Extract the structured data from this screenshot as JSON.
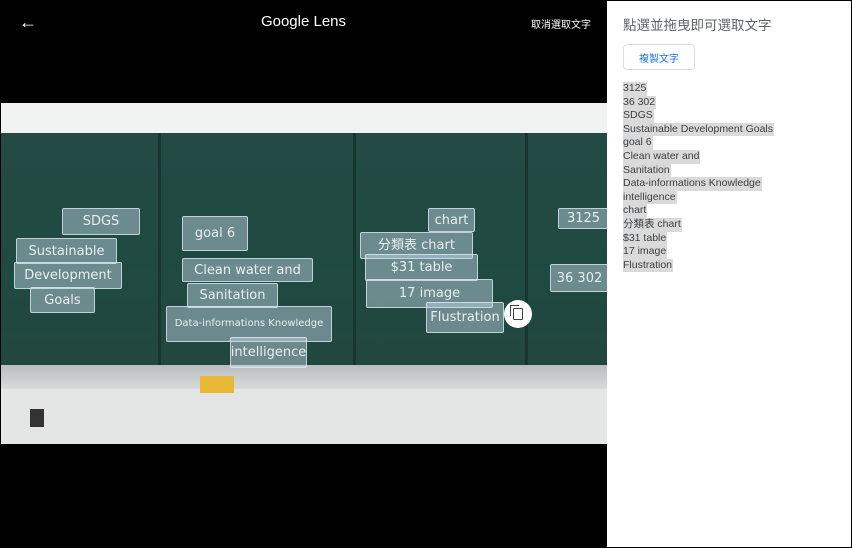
{
  "header": {
    "title": "Google Lens",
    "cancel_label": "取消選取文字",
    "back_icon": "arrow-left-icon"
  },
  "photo": {
    "text_boxes": [
      {
        "text": "SDGS"
      },
      {
        "text": "Sustainable"
      },
      {
        "text": "Development"
      },
      {
        "text": "Goals"
      },
      {
        "text": "goal 6"
      },
      {
        "text": "Clean water and"
      },
      {
        "text": "Sanitation"
      },
      {
        "text": "Data-informations Knowledge"
      },
      {
        "text": "intelligence"
      },
      {
        "text": "chart"
      },
      {
        "text": "分類表 chart"
      },
      {
        "text": "$31 table"
      },
      {
        "text": "17 image"
      },
      {
        "text": "Flustration"
      },
      {
        "text": "3125"
      },
      {
        "text": "36 302"
      }
    ],
    "copy_icon": "copy-icon"
  },
  "panel": {
    "title": "點選並拖曳即可選取文字",
    "copy_button": "複製文字",
    "lines": [
      "3125",
      "36 302",
      "SDGS",
      "Sustainable Development Goals",
      "goal 6",
      "Clean water and",
      "Sanitation",
      "Data-informations Knowledge",
      "intelligence",
      "chart",
      "分類表 chart",
      "$31 table",
      "17 image",
      "Flustration"
    ],
    "highlight_color": "#dadada",
    "accent": "#1a73e8"
  }
}
